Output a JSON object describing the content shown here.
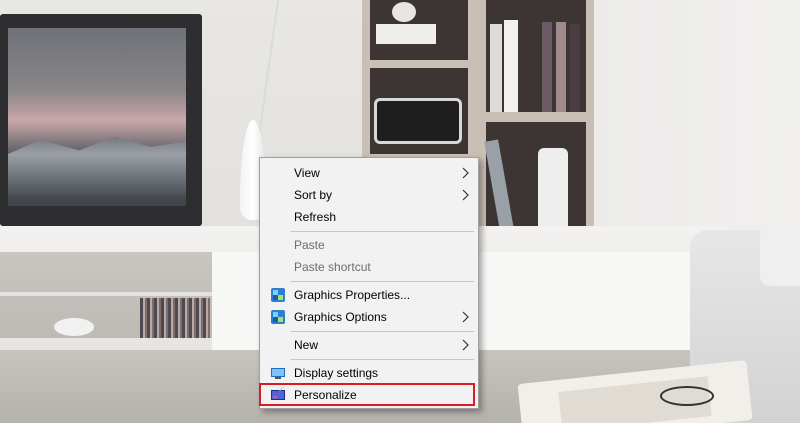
{
  "context_menu": {
    "items": [
      {
        "label": "View",
        "submenu": true,
        "enabled": true
      },
      {
        "label": "Sort by",
        "submenu": true,
        "enabled": true
      },
      {
        "label": "Refresh",
        "submenu": false,
        "enabled": true
      },
      {
        "label": "Paste",
        "submenu": false,
        "enabled": false
      },
      {
        "label": "Paste shortcut",
        "submenu": false,
        "enabled": false
      },
      {
        "label": "Graphics Properties...",
        "submenu": false,
        "enabled": true,
        "icon": "intel-graphics-icon"
      },
      {
        "label": "Graphics Options",
        "submenu": true,
        "enabled": true,
        "icon": "intel-graphics-icon"
      },
      {
        "label": "New",
        "submenu": true,
        "enabled": true
      },
      {
        "label": "Display settings",
        "submenu": false,
        "enabled": true,
        "icon": "display-icon"
      },
      {
        "label": "Personalize",
        "submenu": false,
        "enabled": true,
        "icon": "personalize-icon",
        "highlighted": true
      }
    ]
  },
  "colors": {
    "menu_bg": "#f2f2f2",
    "highlight_border": "#d81b24",
    "disabled_text": "#6d6d6d"
  }
}
